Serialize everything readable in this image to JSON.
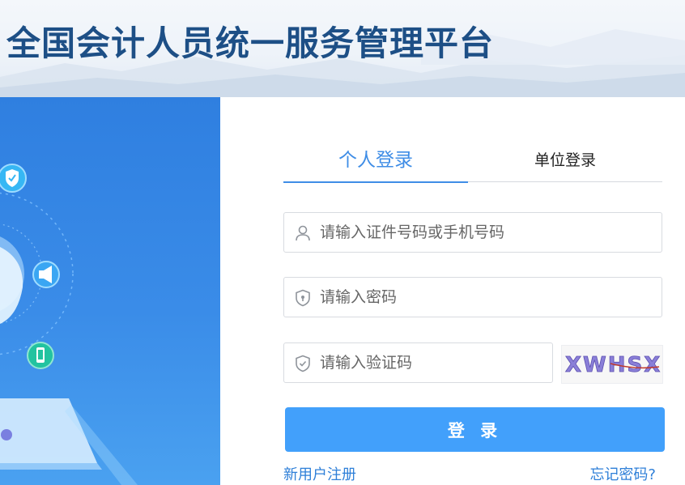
{
  "header": {
    "title": "全国会计人员统一服务管理平台"
  },
  "tabs": {
    "personal": "个人登录",
    "unit": "单位登录"
  },
  "form": {
    "id_placeholder": "请输入证件号码或手机号码",
    "password_placeholder": "请输入密码",
    "captcha_placeholder": "请输入验证码",
    "captcha_image_text": "XWHSX",
    "submit_label": "登 录"
  },
  "links": {
    "register": "新用户注册",
    "forgot": "忘记密码?"
  },
  "icons": {
    "id_field": "user-icon",
    "password_field": "shield-lock-icon",
    "captcha_field": "shield-check-icon",
    "orbit": [
      "shield-check-icon",
      "megaphone-icon",
      "phone-icon"
    ]
  },
  "colors": {
    "title": "#1d4f86",
    "accent": "#3f8de6",
    "button": "#42a0fb",
    "link": "#2e7fd8",
    "panel": "#2f7fe0"
  }
}
